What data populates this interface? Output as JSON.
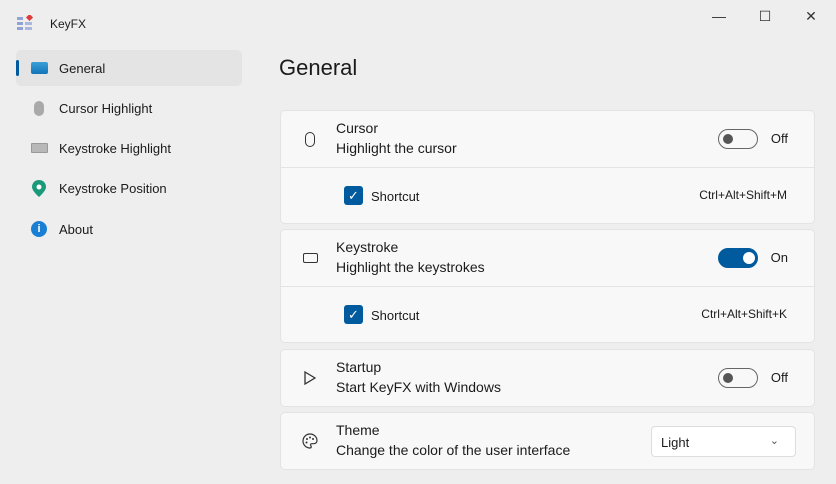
{
  "app": {
    "title": "KeyFX"
  },
  "window": {
    "minimize": "—",
    "maximize": "☐",
    "close": "✕"
  },
  "sidebar": {
    "items": [
      {
        "label": "General",
        "selected": true
      },
      {
        "label": "Cursor Highlight"
      },
      {
        "label": "Keystroke Highlight"
      },
      {
        "label": "Keystroke Position"
      },
      {
        "label": "About"
      }
    ]
  },
  "page": {
    "title": "General"
  },
  "cursor": {
    "title": "Cursor",
    "desc": "Highlight the cursor",
    "state": "Off",
    "shortcut_label": "Shortcut",
    "shortcut": "Ctrl+Alt+Shift+M",
    "shortcut_checked": true
  },
  "keystroke": {
    "title": "Keystroke",
    "desc": "Highlight the keystrokes",
    "state": "On",
    "shortcut_label": "Shortcut",
    "shortcut": "Ctrl+Alt+Shift+K",
    "shortcut_checked": true
  },
  "startup": {
    "title": "Startup",
    "desc": "Start KeyFX with Windows",
    "state": "Off"
  },
  "theme": {
    "title": "Theme",
    "desc": "Change the color of the user interface",
    "value": "Light"
  },
  "colors": {
    "accent": "#005a9e"
  }
}
